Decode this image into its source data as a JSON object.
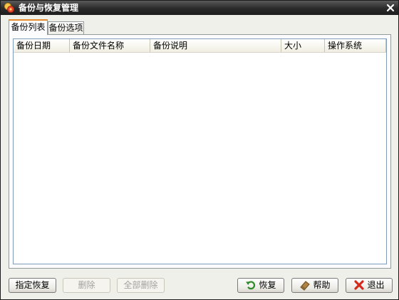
{
  "window": {
    "title": "备份与恢复管理",
    "title_icon": "app-logo-icon",
    "close_icon": "close-icon"
  },
  "tabs": [
    {
      "label": "备份列表",
      "active": true
    },
    {
      "label": "备份选项",
      "active": false
    }
  ],
  "table": {
    "columns": [
      "备份日期",
      "备份文件名称",
      "备份说明",
      "大小",
      "操作系统"
    ],
    "rows": []
  },
  "buttons": {
    "restore_specified": "指定恢复",
    "delete": "删除",
    "delete_all": "全部删除",
    "restore": "恢复",
    "help": "帮助",
    "exit": "退出"
  },
  "icons": {
    "restore": "undo-arrow-icon",
    "help": "eraser-icon",
    "exit": "red-x-icon"
  },
  "colors": {
    "titlebar": "#2a2a2a",
    "active_tab_accent": "#e68b2c",
    "window_background": "#f0f0ea",
    "panel_background": "#fcfcfe"
  }
}
